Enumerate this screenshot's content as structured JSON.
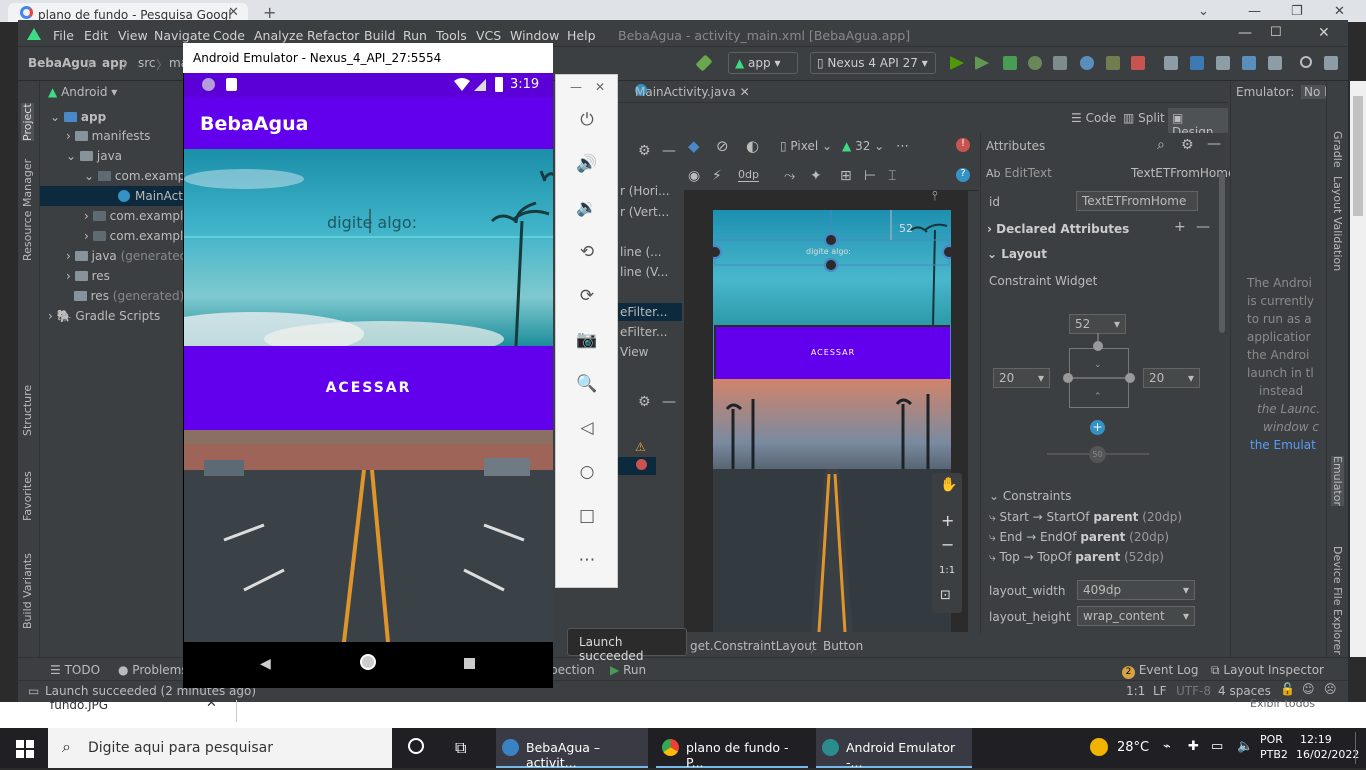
{
  "browser": {
    "tab_title": "plano de fundo - Pesquisa Googl"
  },
  "ide": {
    "menus": [
      "File",
      "Edit",
      "View",
      "Navigate",
      "Code",
      "Analyze",
      "Refactor",
      "Build",
      "Run",
      "Tools",
      "VCS",
      "Window",
      "Help"
    ],
    "window_title": "BebaAgua - activity_main.xml [BebaAgua.app]",
    "breadcrumb": [
      "BebaAgua",
      "app",
      "src",
      "ma"
    ],
    "run_config": "app",
    "device": "Nexus 4 API 27"
  },
  "project": {
    "view_mode": "Android",
    "items": [
      {
        "label": "app",
        "indent": 0,
        "bold": true
      },
      {
        "label": "manifests",
        "indent": 1
      },
      {
        "label": "java",
        "indent": 1
      },
      {
        "label": "com.exampl",
        "indent": 2
      },
      {
        "label": "MainActi",
        "indent": 3
      },
      {
        "label": "com.exampl",
        "indent": 2
      },
      {
        "label": "com.exampl",
        "indent": 2
      },
      {
        "label": "java",
        "suffix": "(generated)",
        "indent": 1
      },
      {
        "label": "res",
        "indent": 1
      },
      {
        "label": "res",
        "suffix": "(generated)",
        "indent": 1
      },
      {
        "label": "Gradle Scripts",
        "indent": 0
      }
    ]
  },
  "left_strip": [
    "Project",
    "Resource Manager",
    "Structure",
    "Favorites",
    "Build Variants"
  ],
  "right_strip": [
    "Gradle",
    "Layout Validation",
    "Emulator",
    "Device File Explorer"
  ],
  "emulator": {
    "title": "Android Emulator - Nexus_4_API_27:5554",
    "time": "3:19",
    "app_title": "BebaAgua",
    "edittext_hint": "digite algo:",
    "button_label": "ACESSAR"
  },
  "editor": {
    "tab": "MainActivity.java",
    "modes": [
      "Code",
      "Split",
      "Design"
    ],
    "device_preview": "Pixel",
    "api_level": "32",
    "zoom_label": "0dp",
    "structure_items": [
      "r (Hori...",
      "r (Vert...",
      "line (...",
      "line (V...",
      "eFilter...",
      "eFilter...",
      "View"
    ],
    "preview_hint": "digite algo:",
    "preview_button": "ACESSAR",
    "margin_top_badge": "52",
    "breadcrumb_bottom": [
      "get.ConstraintLayout",
      "Button"
    ],
    "fit_label": "1:1"
  },
  "attributes": {
    "header": "Attributes",
    "widget_type": "EditText",
    "widget_id_label": "TextETFromHome",
    "id_label": "id",
    "id_value": "TextETFromHome",
    "declared": "Declared Attributes",
    "layout": "Layout",
    "constraint_widget": "Constraint Widget",
    "margin_top": "52",
    "margin_start": "20",
    "margin_end": "20",
    "bias": "50",
    "constraints_header": "Constraints",
    "constraints": [
      {
        "a": "Start → StartOf ",
        "b": "parent",
        "c": " (20dp)"
      },
      {
        "a": "End → EndOf ",
        "b": "parent",
        "c": " (20dp)"
      },
      {
        "a": "Top → TopOf ",
        "b": "parent",
        "c": " (52dp)"
      }
    ],
    "layout_width_label": "layout_width",
    "layout_width": "409dp",
    "layout_height_label": "layout_height",
    "layout_height": "wrap_content"
  },
  "emulator_pane": {
    "tab_title": "Emulator:",
    "tab2": "No I",
    "text_lines": [
      "The Androi",
      "is currently",
      "to run as a",
      "applicatior",
      "the Androi",
      "launch in tl",
      "instead",
      "the Launc.",
      "window c",
      "the Emulat"
    ]
  },
  "bottom": {
    "tabs": [
      "TODO",
      "Problems",
      "pection",
      "Run"
    ],
    "right_tabs": [
      "Event Log",
      "Layout Inspector"
    ],
    "event_count": "2",
    "toast": "Launch succeeded",
    "status": "Launch succeeded (2 minutes ago)",
    "status_right": [
      "1:1",
      "LF",
      "UTF-8",
      "4 spaces"
    ]
  },
  "behind": {
    "file": "fundo.JPG",
    "link": "Exibir todos"
  },
  "taskbar": {
    "search_placeholder": "Digite aqui para pesquisar",
    "apps": [
      "BebaAgua – activit...",
      "plano de fundo - P...",
      "Android Emulator -..."
    ],
    "weather": "28°C",
    "lang": "POR",
    "lang2": "PTB2",
    "time": "12:19",
    "date": "16/02/2022"
  }
}
